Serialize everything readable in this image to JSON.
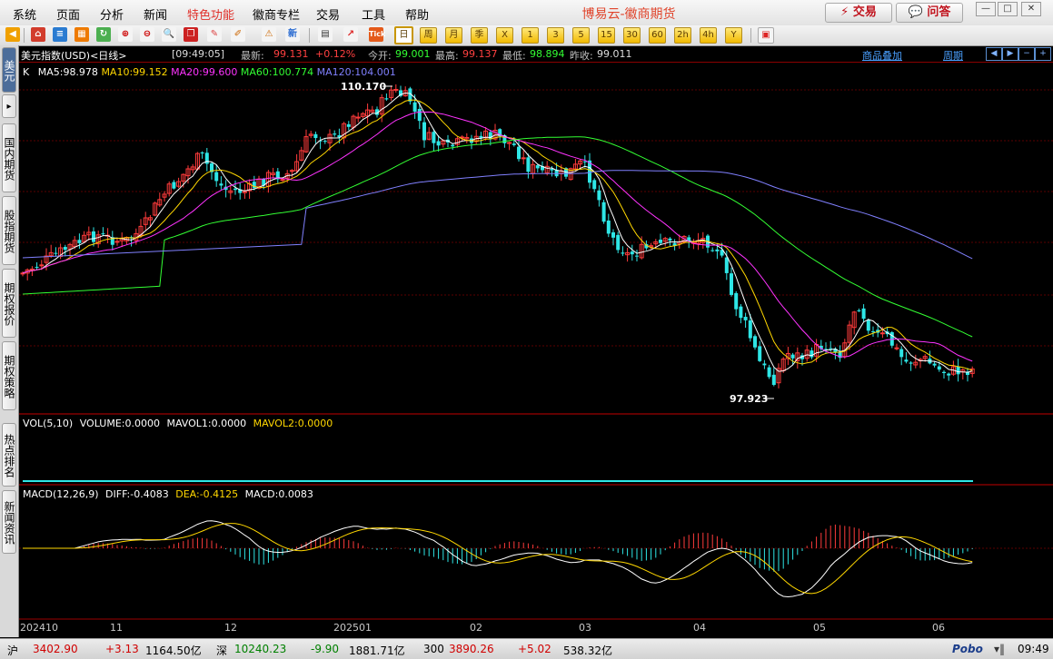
{
  "menu": {
    "items": [
      "系统",
      "页面",
      "分析",
      "新闻",
      "特色功能",
      "徽商专栏",
      "交易",
      "工具",
      "帮助"
    ],
    "app_title": "博易云-徽商期货",
    "trade_button": "⚡ 交易",
    "ask_button": "💬 问答"
  },
  "toolbar": {
    "periods": [
      "日",
      "周",
      "月",
      "季",
      "X",
      "1",
      "3",
      "5",
      "15",
      "30",
      "60",
      "2h",
      "4h",
      "Y"
    ],
    "active_period": "日"
  },
  "side_tabs": [
    "美元",
    "国内期货",
    "股指期货",
    "期权报价",
    "期权策略",
    "热点排名",
    "新闻资讯"
  ],
  "chart_header": {
    "symbol": "美元指数(USD)<日线>",
    "time": "[09:49:05]",
    "latest_label": "最新:",
    "latest_value": "99.131",
    "change": "+0.12%",
    "open_label": "今开:",
    "open_value": "99.001",
    "high_label": "最高:",
    "high_value": "99.137",
    "low_label": "最低:",
    "low_value": "98.894",
    "prev_label": "昨收:",
    "prev_value": "99.011",
    "overlay_link": "商品叠加",
    "period_link": "周期"
  },
  "ma_legend": {
    "k": "K",
    "ma5": "MA5:98.978",
    "ma10": "MA10:99.152",
    "ma20": "MA20:99.600",
    "ma60": "MA60:100.774",
    "ma120": "MA120:104.001"
  },
  "vol_legend": {
    "title": "VOL(5,10)",
    "volume": "VOLUME:0.0000",
    "mavol1": "MAVOL1:0.0000",
    "mavol2": "MAVOL2:0.0000"
  },
  "macd_legend": {
    "title": "MACD(12,26,9)",
    "diff": "DIFF:-0.4083",
    "dea": "DEA:-0.4125",
    "macd": "MACD:0.0083"
  },
  "chart_data": {
    "type": "candlestick",
    "max_label": "110.170",
    "min_label": "97.923",
    "x_labels": [
      "202410",
      "11",
      "12",
      "202501",
      "02",
      "03",
      "04",
      "05",
      "06"
    ],
    "colors": {
      "up": "#ff3b3b",
      "down": "#2ee6e6",
      "ma5": "#ffffff",
      "ma10": "#ffd700",
      "ma20": "#ff33ff",
      "ma60": "#33ff33",
      "ma120": "#8080ff"
    }
  },
  "status_bar": {
    "sh_label": "沪",
    "sh_price": "3402.90",
    "sh_change": "+3.13",
    "sh_amount": "1164.50亿",
    "sz_label": "深",
    "sz_price": "10240.23",
    "sz_change": "-9.90",
    "sz_amount": "1881.71亿",
    "idx_label": "300",
    "idx_price": "3890.26",
    "idx_change": "+5.02",
    "idx_amount": "538.32亿",
    "brand": "Pobo",
    "clock": "09:49"
  }
}
